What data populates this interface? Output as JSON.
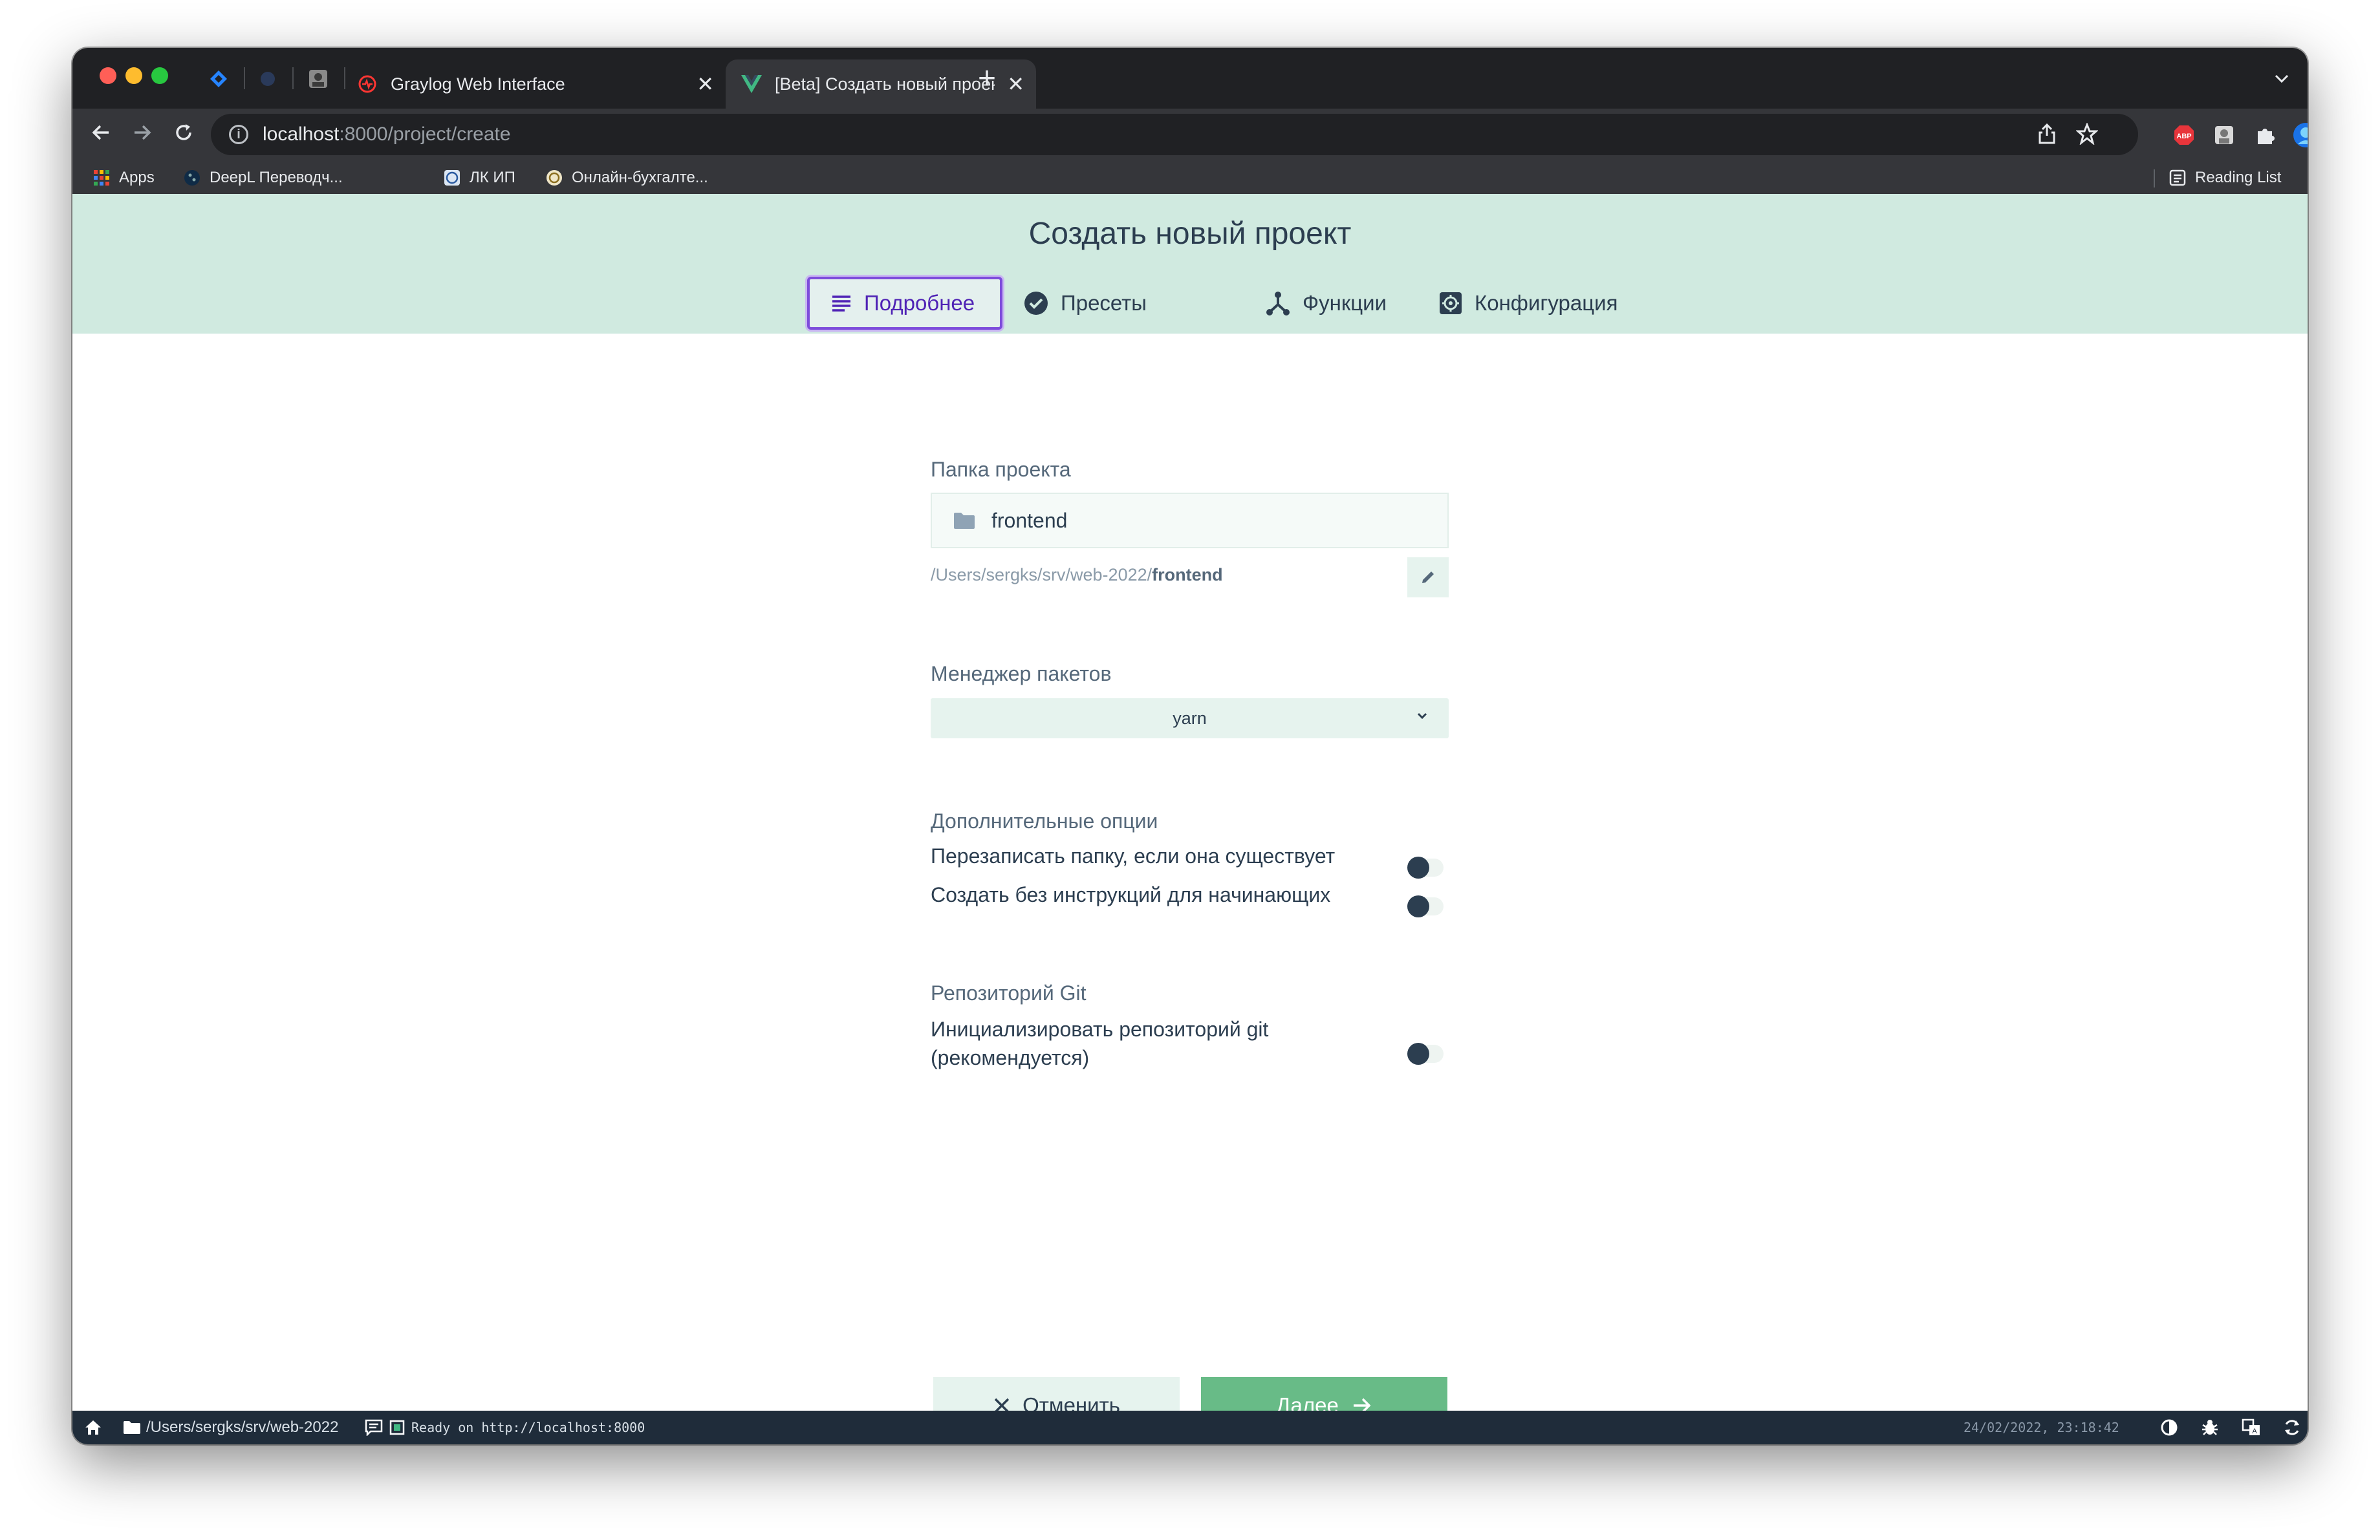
{
  "browser": {
    "tabs": [
      {
        "title": "Graylog Web Interface",
        "active": false
      },
      {
        "title": "[Beta] Создать новый проект",
        "active": true
      }
    ],
    "url_host": "localhost",
    "url_rest": ":8000/project/create",
    "bookmarks": [
      "Apps",
      "DeepL Переводч...",
      "ЛК ИП",
      "Онлайн-бухгалте..."
    ],
    "reading_list": "Reading List",
    "colors": {
      "tabstrip": "#202124",
      "toolbar": "#35363a"
    }
  },
  "page": {
    "title": "Создать новый проект",
    "tabs": [
      {
        "label": "Подробнее",
        "icon": "list-icon",
        "selected": true
      },
      {
        "label": "Пресеты",
        "icon": "check-circle-icon"
      },
      {
        "label": "Функции",
        "icon": "branch-icon"
      },
      {
        "label": "Конфигурация",
        "icon": "gear-icon"
      }
    ],
    "colors": {
      "header": "#d0eae0",
      "accent": "#7d4cdb",
      "primary": "#68bb87",
      "text": "#2c3e50"
    }
  },
  "form": {
    "folder": {
      "label": "Папка проекта",
      "value": "frontend",
      "path_prefix": "/Users/sergks/srv/web-2022/",
      "path_name": "frontend"
    },
    "package_manager": {
      "label": "Менеджер пакетов",
      "value": "yarn"
    },
    "options": {
      "label": "Дополнительные опции",
      "items": [
        {
          "label": "Перезаписать папку, если она существует",
          "on": false
        },
        {
          "label": "Создать без инструкций для начинающих",
          "on": false
        }
      ]
    },
    "git": {
      "label": "Репозиторий Git",
      "line1": "Инициализировать репозиторий git",
      "line2": "(рекомендуется)",
      "on": false
    }
  },
  "actions": {
    "cancel": "Отменить",
    "next": "Далее"
  },
  "statusbar": {
    "cwd": "/Users/sergks/srv/web-2022",
    "log": "Ready on http://localhost:8000",
    "datetime": "24/02/2022, 23:18:42"
  }
}
